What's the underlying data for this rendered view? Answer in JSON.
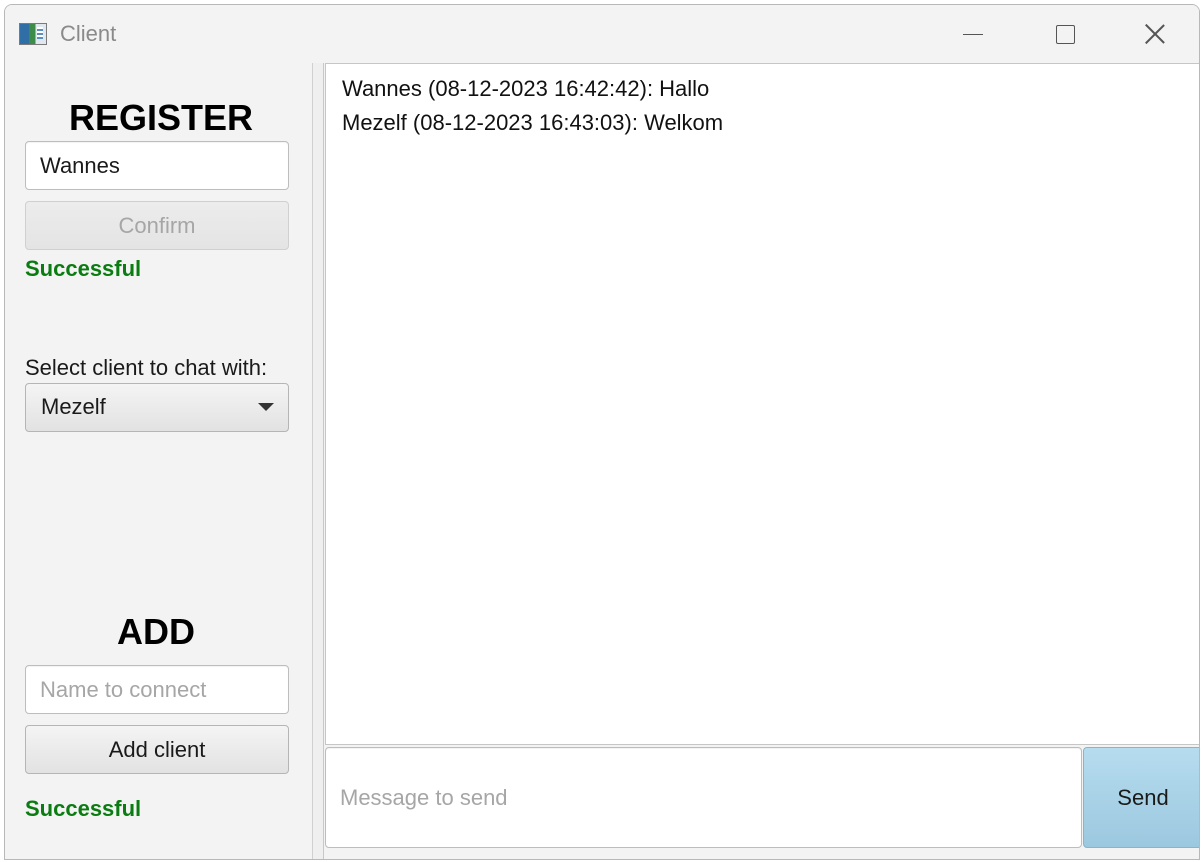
{
  "window": {
    "title": "Client",
    "controls": {
      "minimize": "minimize-icon",
      "maximize": "maximize-icon",
      "close": "close-icon"
    }
  },
  "register": {
    "heading": "REGISTER",
    "name_value": "Wannes",
    "confirm_label": "Confirm",
    "status": "Successful"
  },
  "select_client": {
    "label": "Select client to chat with:",
    "selected": "Mezelf"
  },
  "add": {
    "heading": "ADD",
    "name_placeholder": "Name to connect",
    "button_label": "Add client",
    "status": "Successful"
  },
  "chat": {
    "messages": [
      "Wannes (08-12-2023 16:42:42): Hallo",
      "Mezelf (08-12-2023 16:43:03): Welkom"
    ],
    "input_placeholder": "Message to send",
    "send_label": "Send"
  },
  "colors": {
    "status_success": "#0a7c12",
    "send_button": "#a9d3e8",
    "window_bg": "#f3f3f3"
  }
}
